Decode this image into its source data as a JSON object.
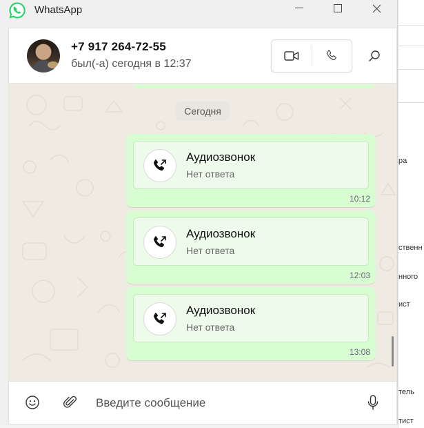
{
  "window": {
    "app_title": "WhatsApp",
    "controls": [
      "minimize-icon",
      "maximize-icon",
      "close-icon"
    ]
  },
  "chat_header": {
    "contact_name": "+7 917 264-72-55",
    "status": "был(-а) сегодня в 12:37",
    "actions": [
      "video-call-icon",
      "voice-call-icon",
      "search-icon"
    ]
  },
  "messages": {
    "date_separator": "Сегодня",
    "calls": [
      {
        "title": "Аудиозвонок",
        "subtitle": "Нет ответа",
        "time": "10:12"
      },
      {
        "title": "Аудиозвонок",
        "subtitle": "Нет ответа",
        "time": "12:03"
      },
      {
        "title": "Аудиозвонок",
        "subtitle": "Нет ответа",
        "time": "13:08"
      }
    ]
  },
  "composer": {
    "placeholder": "Введите сообщение",
    "icons": [
      "emoji-icon",
      "attach-icon",
      "microphone-icon"
    ]
  },
  "background_window": {
    "texts": [
      "ра",
      "ственн",
      "нного",
      "ист",
      "тель",
      "тист"
    ]
  },
  "colors": {
    "brand": "#25d366",
    "outgoing_bubble": "#d9fdd3",
    "chat_background": "#efeae2"
  }
}
